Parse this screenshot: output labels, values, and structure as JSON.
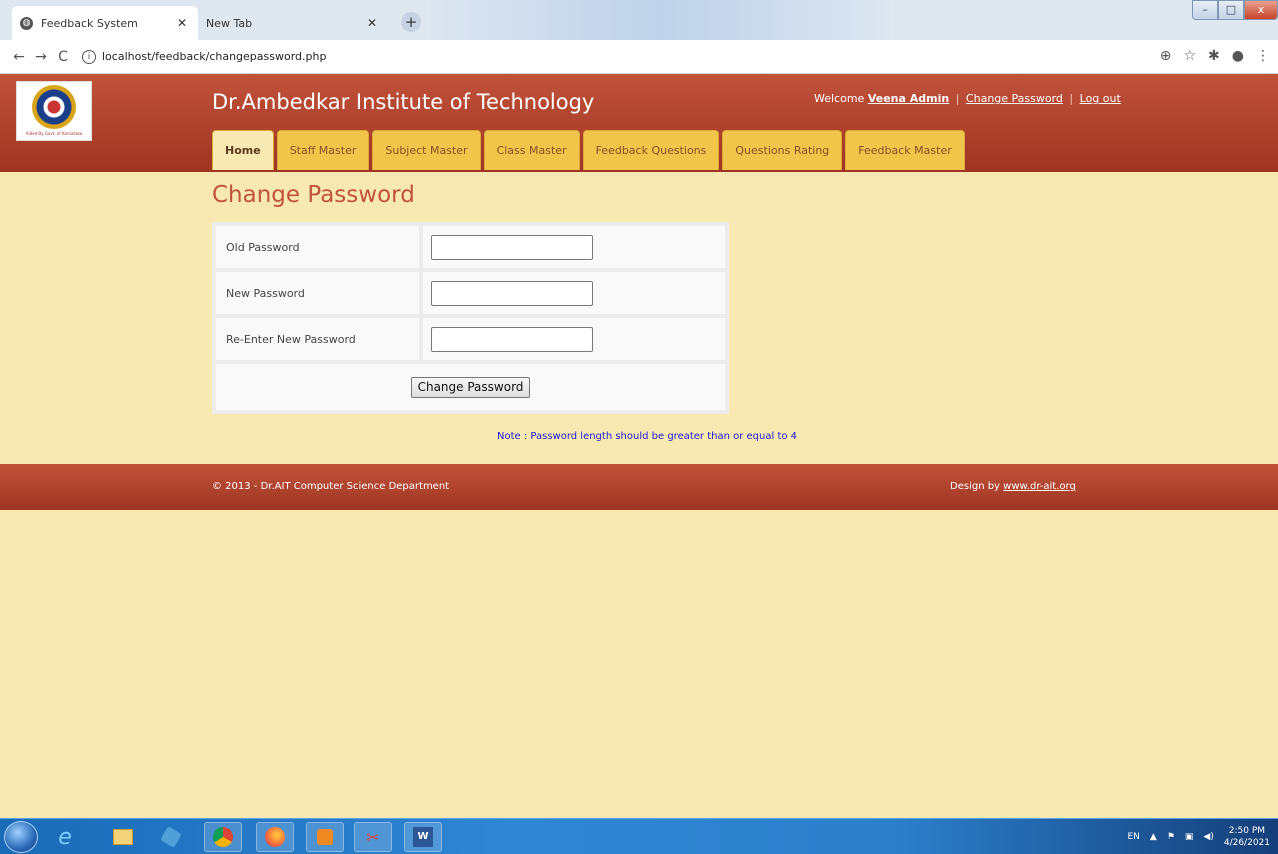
{
  "browser": {
    "tabs": [
      {
        "label": "Feedback System",
        "active": true
      },
      {
        "label": "New Tab",
        "active": false
      }
    ],
    "url": "localhost/feedback/changepassword.php",
    "window_controls": {
      "minimize": "–",
      "maximize": "□",
      "close": "x"
    }
  },
  "header": {
    "title": "Dr.Ambedkar Institute of Technology",
    "welcome_prefix": "Welcome",
    "user_name": "Veena Admin",
    "change_password_link": "Change Password",
    "logout_link": "Log out",
    "separator": "|",
    "logo_motto": "Aided By Govt. of Karnataka"
  },
  "menu": [
    {
      "label": "Home",
      "active": true
    },
    {
      "label": "Staff Master",
      "active": false
    },
    {
      "label": "Subject Master",
      "active": false
    },
    {
      "label": "Class Master",
      "active": false
    },
    {
      "label": "Feedback Questions",
      "active": false
    },
    {
      "label": "Questions Rating",
      "active": false
    },
    {
      "label": "Feedback Master",
      "active": false
    }
  ],
  "form": {
    "heading": "Change Password",
    "fields": [
      {
        "label": "Old Password",
        "value": ""
      },
      {
        "label": "New Password",
        "value": ""
      },
      {
        "label": "Re-Enter New Password",
        "value": ""
      }
    ],
    "submit_label": "Change Password",
    "note": "Note : Password length should be greater than or equal to 4"
  },
  "footer": {
    "copyright": "© 2013 - Dr.AIT Computer Science Department",
    "design_prefix": "Design by",
    "design_link": "www.dr-ait.org"
  },
  "taskbar": {
    "language": "EN",
    "time": "2:50 PM",
    "date": "4/26/2021",
    "apps": [
      "internet-explorer-icon",
      "file-explorer-icon",
      "media-icon",
      "chrome-icon",
      "firefox-icon",
      "media-player-icon",
      "snipping-tool-icon",
      "word-icon"
    ]
  },
  "colors": {
    "header_bg": "#c2523a",
    "page_bg": "#f8e9b3",
    "menu_tab": "#f0c54a",
    "heading": "#c2523a",
    "note": "#1a1adc"
  }
}
